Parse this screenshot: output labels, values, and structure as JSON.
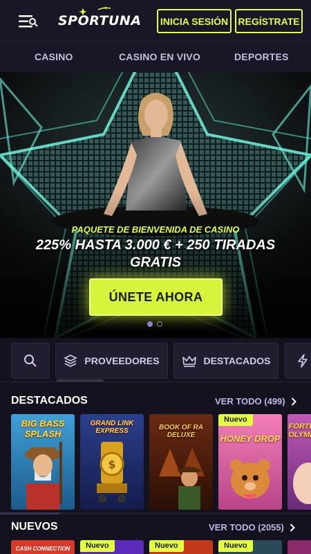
{
  "header": {
    "logo": "SPORTUNA",
    "login_label": "INICIA SESIÓN",
    "register_label": "REGÍSTRATE"
  },
  "nav": {
    "items": [
      "CASINO",
      "CASINO EN VIVO",
      "DEPORTES"
    ]
  },
  "hero": {
    "subtitle": "PAQUETE DE BIENVENIDA DE CASINO",
    "title": "225% HASTA 3.000 € + 250 TIRADAS GRATIS",
    "cta": "ÚNETE AHORA",
    "slides": 2,
    "active_slide": 1
  },
  "filters": {
    "providers_label": "PROVEEDORES",
    "featured_label": "DESTACADOS"
  },
  "featured": {
    "title": "DESTACADOS",
    "view_all": "VER TODO (499)",
    "games": [
      {
        "name": "BIG BASS SPLASH",
        "new": false
      },
      {
        "name": "GRAND LINK EXPRESS",
        "new": false
      },
      {
        "name": "BOOK OF RA DELUXE",
        "new": false
      },
      {
        "name": "HONEY DROP",
        "new": true,
        "badge": "Nuevo"
      },
      {
        "name": "FORTUNE OLYMPUS",
        "new": false
      }
    ]
  },
  "new_games": {
    "title": "NUEVOS",
    "view_all": "VER TODO (2055)",
    "badges": [
      "Nuevo",
      "Nuevo",
      "Nuevo"
    ],
    "first_tile_label": "CASH CONNECTION"
  },
  "colors": {
    "accent": "#e4ff3c",
    "background": "#15121f",
    "header": "#1a1626",
    "link": "#bfb6e6"
  }
}
